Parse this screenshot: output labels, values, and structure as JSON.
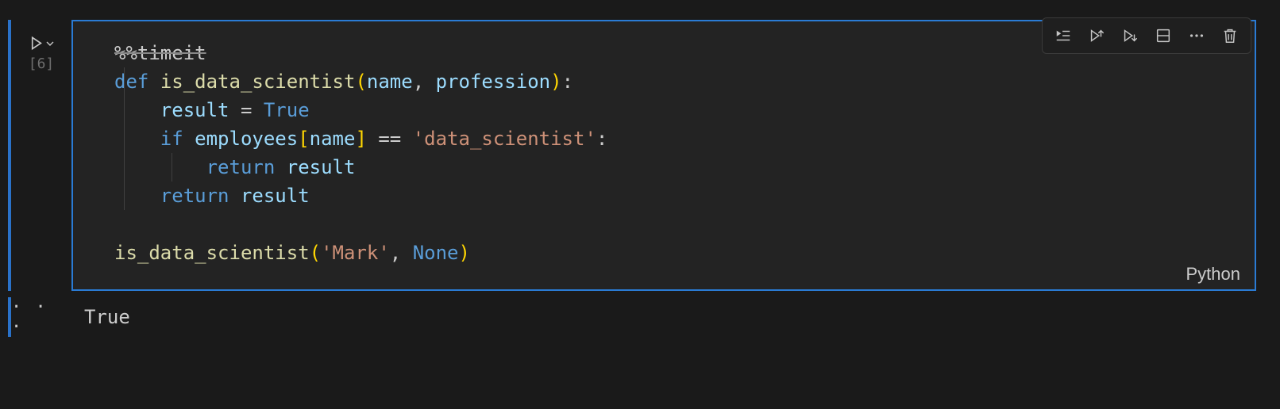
{
  "cell": {
    "execution_count": "[6]",
    "language": "Python",
    "code": {
      "line1_magic": "%%timeit",
      "line2_def": "def",
      "line2_fn": "is_data_scientist",
      "line2_p1": "name",
      "line2_sep": ", ",
      "line2_p2": "profession",
      "line3_var": "result",
      "line3_eq": " = ",
      "line3_true": "True",
      "line4_if": "if",
      "line4_emp": "employees",
      "line4_name": "name",
      "line4_eqop": " == ",
      "line4_str": "'data_scientist'",
      "line5_return": "return",
      "line5_var": "result",
      "line6_return": "return",
      "line6_var": "result",
      "line8_fn": "is_data_scientist",
      "line8_arg1": "'Mark'",
      "line8_sep": ", ",
      "line8_arg2": "None"
    }
  },
  "output": {
    "text": "True",
    "menu": "· · ·"
  },
  "toolbar": {
    "run_by_line": "run-by-line",
    "execute_above": "execute-above",
    "execute_below": "execute-below",
    "split": "split-cell",
    "more": "more-actions",
    "delete": "delete-cell"
  }
}
